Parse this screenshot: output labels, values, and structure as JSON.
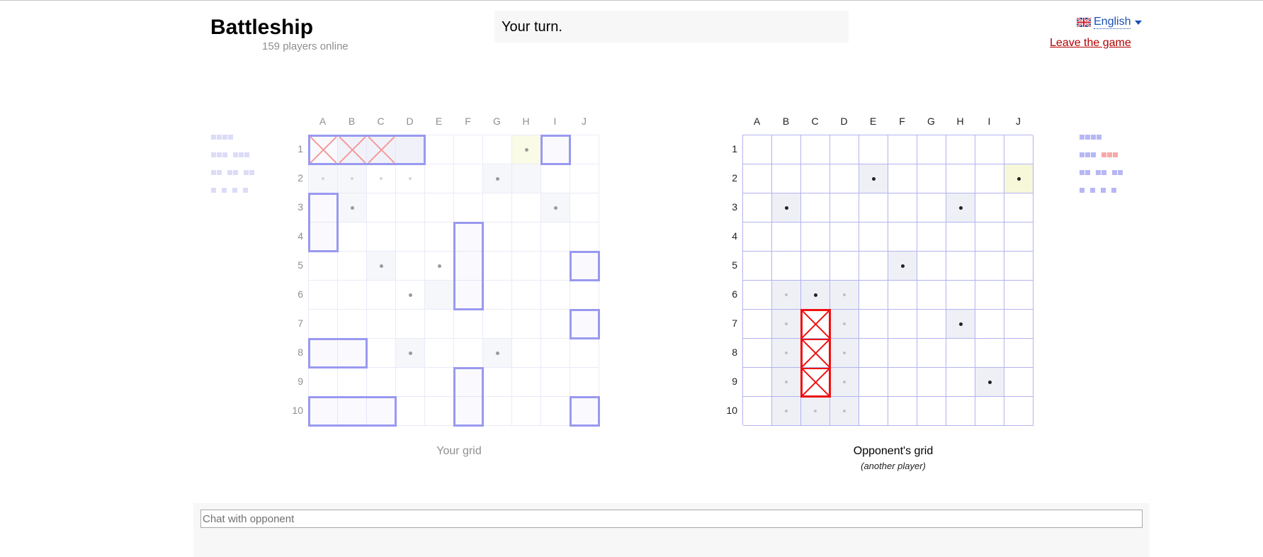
{
  "header": {
    "title": "Battleship",
    "players_online": "159 players online",
    "status": "Your turn.",
    "language": "English",
    "leave": "Leave the game"
  },
  "columns": [
    "A",
    "B",
    "C",
    "D",
    "E",
    "F",
    "G",
    "H",
    "I",
    "J"
  ],
  "rows": [
    "1",
    "2",
    "3",
    "4",
    "5",
    "6",
    "7",
    "8",
    "9",
    "10"
  ],
  "my_grid": {
    "caption": "Your grid",
    "shaded": [
      [
        1,
        0
      ],
      [
        2,
        0
      ],
      [
        3,
        0
      ],
      [
        6,
        1
      ],
      [
        2,
        4
      ],
      [
        4,
        5
      ],
      [
        3,
        7
      ],
      [
        6,
        7
      ],
      [
        0,
        1
      ],
      [
        1,
        1
      ],
      [
        1,
        2
      ],
      [
        7,
        1
      ],
      [
        8,
        2
      ]
    ],
    "last": [
      [
        7,
        0
      ]
    ],
    "dots_strong": [
      [
        7,
        0
      ],
      [
        6,
        1
      ],
      [
        1,
        2
      ],
      [
        8,
        2
      ],
      [
        2,
        4
      ],
      [
        4,
        4
      ],
      [
        3,
        5
      ],
      [
        3,
        7
      ],
      [
        6,
        7
      ]
    ],
    "dots_faint": [
      [
        0,
        1
      ],
      [
        1,
        1
      ],
      [
        2,
        1
      ],
      [
        3,
        1
      ]
    ],
    "ships": [
      {
        "col": 0,
        "row": 0,
        "len": 4,
        "dir": "h",
        "hits": [
          0,
          1,
          2
        ]
      },
      {
        "col": 8,
        "row": 0,
        "len": 1,
        "dir": "h",
        "hits": []
      },
      {
        "col": 0,
        "row": 2,
        "len": 2,
        "dir": "v",
        "hits": []
      },
      {
        "col": 5,
        "row": 3,
        "len": 3,
        "dir": "v",
        "hits": []
      },
      {
        "col": 9,
        "row": 4,
        "len": 1,
        "dir": "h",
        "hits": []
      },
      {
        "col": 9,
        "row": 6,
        "len": 1,
        "dir": "h",
        "hits": []
      },
      {
        "col": 0,
        "row": 7,
        "len": 2,
        "dir": "h",
        "hits": []
      },
      {
        "col": 5,
        "row": 8,
        "len": 2,
        "dir": "v",
        "hits": []
      },
      {
        "col": 0,
        "row": 9,
        "len": 3,
        "dir": "h",
        "hits": []
      },
      {
        "col": 9,
        "row": 9,
        "len": 1,
        "dir": "h",
        "hits": []
      }
    ]
  },
  "opponent_grid": {
    "caption": "Opponent's grid",
    "subcaption": "(another player)",
    "shaded": [
      [
        4,
        1
      ],
      [
        1,
        2
      ],
      [
        7,
        2
      ],
      [
        5,
        4
      ],
      [
        1,
        5
      ],
      [
        2,
        5
      ],
      [
        3,
        5
      ],
      [
        1,
        6
      ],
      [
        3,
        6
      ],
      [
        7,
        6
      ],
      [
        1,
        7
      ],
      [
        3,
        7
      ],
      [
        1,
        8
      ],
      [
        3,
        8
      ],
      [
        8,
        8
      ],
      [
        1,
        9
      ],
      [
        2,
        9
      ],
      [
        3,
        9
      ]
    ],
    "last": [
      [
        9,
        1
      ]
    ],
    "dots_strong": [
      [
        4,
        1
      ],
      [
        9,
        1
      ],
      [
        1,
        2
      ],
      [
        7,
        2
      ],
      [
        5,
        4
      ],
      [
        2,
        5
      ],
      [
        7,
        6
      ],
      [
        8,
        8
      ]
    ],
    "dots_faint": [
      [
        1,
        5
      ],
      [
        3,
        5
      ],
      [
        1,
        6
      ],
      [
        3,
        6
      ],
      [
        1,
        7
      ],
      [
        3,
        7
      ],
      [
        1,
        8
      ],
      [
        3,
        8
      ],
      [
        1,
        9
      ],
      [
        2,
        9
      ],
      [
        3,
        9
      ]
    ],
    "sunk": [
      {
        "col": 2,
        "row": 6,
        "len": 3,
        "dir": "v"
      }
    ]
  },
  "my_fleet": [
    [
      4
    ],
    [
      3,
      3
    ],
    [
      2,
      2,
      2
    ],
    [
      1,
      1,
      1,
      1
    ]
  ],
  "opp_fleet": [
    [
      4
    ],
    [
      3,
      3
    ],
    [
      2,
      2,
      2
    ],
    [
      1,
      1,
      1,
      1
    ]
  ],
  "opp_fleet_sunk": [
    [
      1,
      1
    ]
  ],
  "colors": {
    "ship": "#9999f0",
    "hit_mine": "#f49a9a",
    "hit_opp": "#ee1111"
  },
  "chat": {
    "placeholder": "Chat with opponent"
  }
}
